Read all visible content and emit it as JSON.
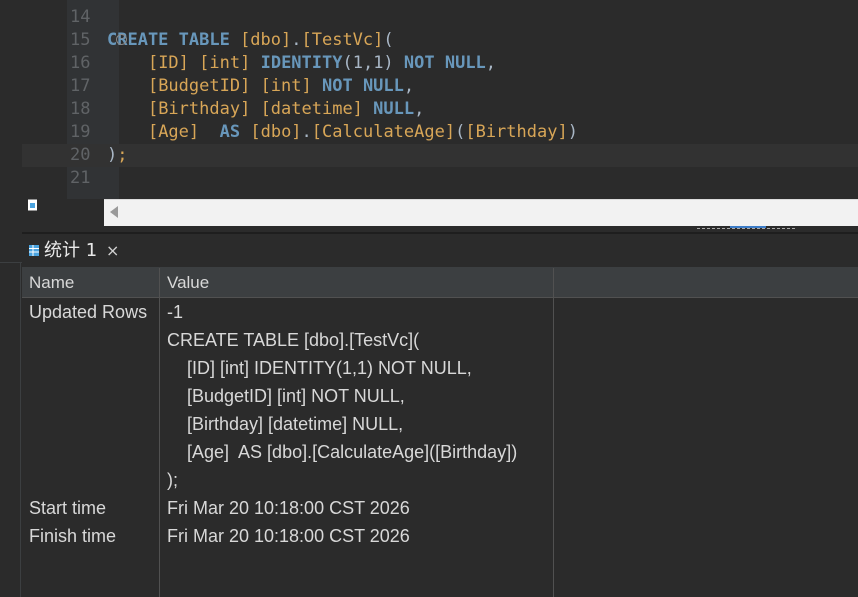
{
  "editor": {
    "lines": [
      {
        "num": "14",
        "tokens": []
      },
      {
        "num": "15",
        "tokens": [
          {
            "t": "CREATE TABLE ",
            "c": "kw"
          },
          {
            "t": "[dbo]",
            "c": "br"
          },
          {
            "t": ".",
            "c": "ph"
          },
          {
            "t": "[TestVc]",
            "c": "br"
          },
          {
            "t": "(",
            "c": "ph"
          }
        ]
      },
      {
        "num": "16",
        "tokens": [
          {
            "t": "    ",
            "c": "ph"
          },
          {
            "t": "[ID]",
            "c": "br"
          },
          {
            "t": " ",
            "c": "ph"
          },
          {
            "t": "[int]",
            "c": "br"
          },
          {
            "t": " ",
            "c": "ph"
          },
          {
            "t": "IDENTITY",
            "c": "kw"
          },
          {
            "t": "(1,1) ",
            "c": "ph"
          },
          {
            "t": "NOT NULL",
            "c": "kw"
          },
          {
            "t": ",",
            "c": "ph"
          }
        ]
      },
      {
        "num": "17",
        "tokens": [
          {
            "t": "    ",
            "c": "ph"
          },
          {
            "t": "[BudgetID]",
            "c": "br"
          },
          {
            "t": " ",
            "c": "ph"
          },
          {
            "t": "[int]",
            "c": "br"
          },
          {
            "t": " ",
            "c": "ph"
          },
          {
            "t": "NOT NULL",
            "c": "kw"
          },
          {
            "t": ",",
            "c": "ph"
          }
        ]
      },
      {
        "num": "18",
        "tokens": [
          {
            "t": "    ",
            "c": "ph"
          },
          {
            "t": "[Birthday]",
            "c": "br"
          },
          {
            "t": " ",
            "c": "ph"
          },
          {
            "t": "[datetime]",
            "c": "br"
          },
          {
            "t": " ",
            "c": "ph"
          },
          {
            "t": "NULL",
            "c": "kw"
          },
          {
            "t": ",",
            "c": "ph"
          }
        ]
      },
      {
        "num": "19",
        "tokens": [
          {
            "t": "    ",
            "c": "ph"
          },
          {
            "t": "[Age]",
            "c": "br"
          },
          {
            "t": "  ",
            "c": "ph"
          },
          {
            "t": "AS",
            "c": "kw"
          },
          {
            "t": " ",
            "c": "ph"
          },
          {
            "t": "[dbo]",
            "c": "br"
          },
          {
            "t": ".",
            "c": "ph"
          },
          {
            "t": "[CalculateAge]",
            "c": "br"
          },
          {
            "t": "(",
            "c": "ph"
          },
          {
            "t": "[Birthday]",
            "c": "br"
          },
          {
            "t": ")",
            "c": "ph"
          }
        ]
      },
      {
        "num": "20",
        "tokens": [
          {
            "t": ")",
            "c": "ph"
          },
          {
            "t": ";",
            "c": "br"
          }
        ]
      },
      {
        "num": "21",
        "tokens": []
      }
    ]
  },
  "results_tab": {
    "label": "统计 1",
    "close": "×"
  },
  "grid": {
    "columns": [
      "Name",
      "Value"
    ],
    "rows": [
      {
        "name": "Updated Rows",
        "value_lines": [
          "-1",
          "CREATE TABLE [dbo].[TestVc](",
          "    [ID] [int] IDENTITY(1,1) NOT NULL,",
          "    [BudgetID] [int] NOT NULL,",
          "    [Birthday] [datetime] NULL,",
          "    [Age]  AS [dbo].[CalculateAge]([Birthday])",
          ");"
        ]
      },
      {
        "name": "Start time",
        "value_lines": [
          "Fri Mar 20 10:18:00 CST 2026"
        ]
      },
      {
        "name": "Finish time",
        "value_lines": [
          "Fri Mar 20 10:18:00 CST 2026"
        ]
      }
    ]
  },
  "colors": {
    "keyword": "#6897bb",
    "bracket_ident": "#d8a657",
    "plain": "#a9b7c6",
    "background": "#2b2b2b",
    "header": "#3c3f41"
  }
}
